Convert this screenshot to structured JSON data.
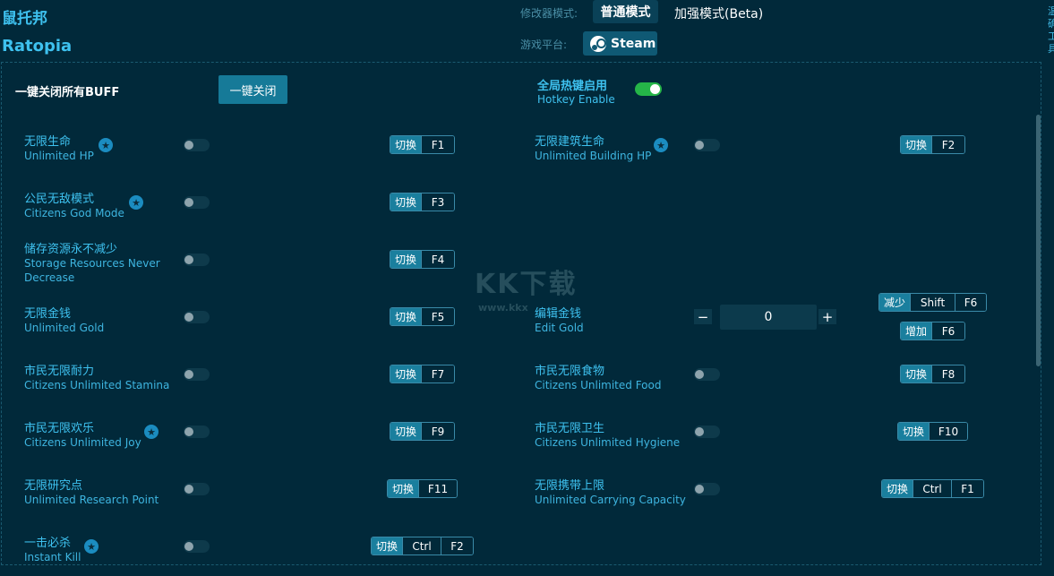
{
  "app": {
    "title_cn": "鼠托邦",
    "title_en": "Ratopia"
  },
  "mode": {
    "label": "修改器模式:",
    "normal": "普通模式",
    "beta": "加强模式(Beta)"
  },
  "platform": {
    "label": "游戏平台:",
    "steam": "Steam"
  },
  "right_edge_text": [
    "温",
    "确",
    "工",
    "具"
  ],
  "global": {
    "all_off_label": "一键关闭所有BUFF",
    "all_off_button": "一键关闭",
    "hotkey_cn": "全局热键启用",
    "hotkey_en": "Hotkey Enable",
    "hotkey_enabled": true
  },
  "watermark": {
    "main": "KK下载",
    "sub": "www.kkx"
  },
  "options": [
    {
      "cn": "无限生命",
      "en": "Unlimited HP",
      "star": true,
      "action": "切换",
      "keys": [
        "F1"
      ]
    },
    {
      "cn": "无限建筑生命",
      "en": "Unlimited Building HP",
      "star": true,
      "action": "切换",
      "keys": [
        "F2"
      ]
    },
    {
      "cn": "公民无敌模式",
      "en": "Citizens God Mode",
      "star": true,
      "action": "切换",
      "keys": [
        "F3"
      ]
    },
    {
      "cn": "储存资源永不减少",
      "en": "Storage Resources Never Decrease",
      "star": false,
      "action": "切换",
      "keys": [
        "F4"
      ]
    },
    {
      "cn": "无限金钱",
      "en": "Unlimited Gold",
      "star": false,
      "action": "切换",
      "keys": [
        "F5"
      ]
    },
    {
      "cn": "编辑金钱",
      "en": "Edit Gold",
      "value": "0",
      "dec_action": "减少",
      "dec_keys": [
        "Shift",
        "F6"
      ],
      "inc_action": "增加",
      "inc_keys": [
        "F6"
      ]
    },
    {
      "cn": "市民无限耐力",
      "en": "Citizens Unlimited Stamina",
      "star": false,
      "action": "切换",
      "keys": [
        "F7"
      ]
    },
    {
      "cn": "市民无限食物",
      "en": "Citizens Unlimited Food",
      "star": false,
      "action": "切换",
      "keys": [
        "F8"
      ]
    },
    {
      "cn": "市民无限欢乐",
      "en": "Citizens Unlimited Joy",
      "star": true,
      "action": "切换",
      "keys": [
        "F9"
      ]
    },
    {
      "cn": "市民无限卫生",
      "en": "Citizens Unlimited Hygiene",
      "star": false,
      "action": "切换",
      "keys": [
        "F10"
      ]
    },
    {
      "cn": "无限研究点",
      "en": "Unlimited Research Point",
      "star": false,
      "action": "切换",
      "keys": [
        "F11"
      ]
    },
    {
      "cn": "无限携带上限",
      "en": "Unlimited Carrying Capacity",
      "star": false,
      "action": "切换",
      "keys": [
        "Ctrl",
        "F1"
      ]
    },
    {
      "cn": "一击必杀",
      "en": "Instant Kill",
      "star": true,
      "action": "切换",
      "keys": [
        "Ctrl",
        "F2"
      ]
    }
  ]
}
